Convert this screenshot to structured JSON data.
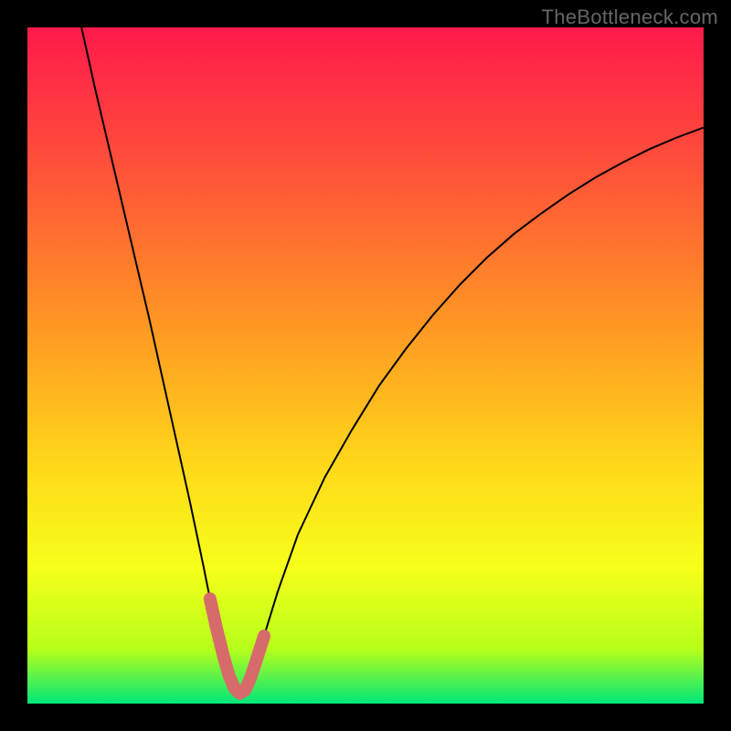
{
  "watermark": "TheBottleneck.com",
  "chart_data": {
    "type": "line",
    "title": "",
    "xlabel": "",
    "ylabel": "",
    "xlim": [
      0,
      100
    ],
    "ylim": [
      0,
      100
    ],
    "grid": false,
    "legend": false,
    "gradient_stops": [
      {
        "offset": 0.0,
        "color": "#ff1a4b"
      },
      {
        "offset": 0.2,
        "color": "#ff4f3a"
      },
      {
        "offset": 0.45,
        "color": "#ff9a22"
      },
      {
        "offset": 0.65,
        "color": "#ffd91a"
      },
      {
        "offset": 0.8,
        "color": "#f6ff1a"
      },
      {
        "offset": 0.92,
        "color": "#b6ff1a"
      },
      {
        "offset": 1.0,
        "color": "#00e67a"
      }
    ],
    "series": [
      {
        "name": "bottleneck-curve",
        "color": "#000000",
        "x": [
          8.0,
          10.0,
          12.0,
          14.0,
          16.0,
          18.0,
          20.0,
          22.0,
          24.0,
          26.0,
          27.0,
          28.0,
          29.0,
          29.8,
          30.6,
          31.4,
          32.2,
          33.0,
          33.8,
          35.0,
          37.0,
          40.0,
          44.0,
          48.0,
          52.0,
          56.0,
          60.0,
          64.0,
          68.0,
          72.0,
          76.0,
          80.0,
          84.0,
          88.0,
          92.0,
          96.0,
          100.0
        ],
        "y": [
          100.0,
          91.0,
          82.5,
          74.0,
          65.5,
          57.0,
          48.0,
          39.0,
          30.0,
          20.5,
          15.5,
          11.0,
          7.0,
          4.2,
          2.3,
          1.5,
          2.0,
          3.8,
          6.2,
          10.0,
          16.5,
          25.0,
          33.5,
          40.5,
          47.0,
          52.5,
          57.5,
          62.0,
          66.0,
          69.5,
          72.5,
          75.3,
          77.8,
          80.0,
          82.0,
          83.7,
          85.2
        ]
      }
    ],
    "annotations": {
      "red_v_marker": {
        "color": "#d76a6a",
        "x": [
          27.0,
          28.0,
          29.0,
          29.8,
          30.6,
          31.4,
          32.2,
          33.0,
          33.8,
          35.0
        ],
        "y": [
          15.5,
          11.0,
          7.0,
          4.2,
          2.3,
          1.5,
          2.0,
          3.8,
          6.2,
          10.0
        ]
      }
    }
  }
}
